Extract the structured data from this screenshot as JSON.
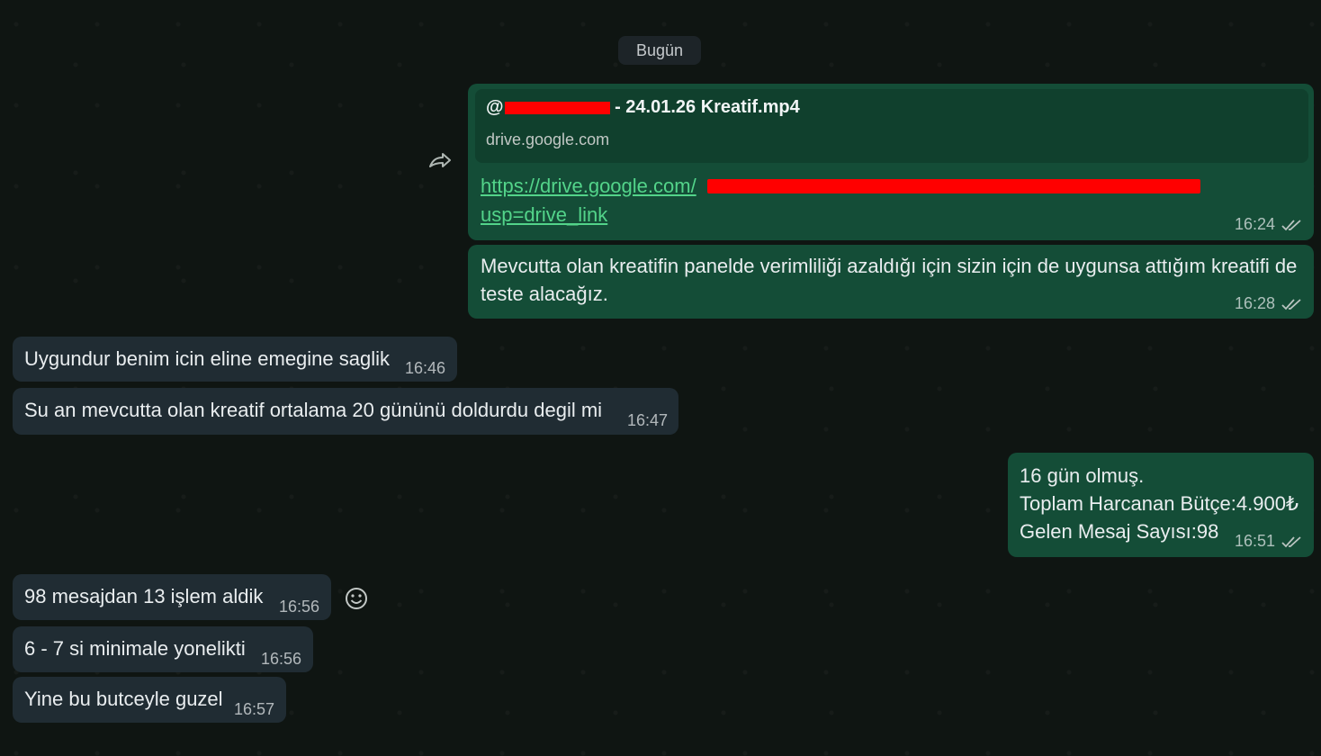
{
  "date_label": "Bugün",
  "outgoing": {
    "link_preview": {
      "title_prefix": "@",
      "title_suffix": " - 24.01.26 Kreatif.mp4",
      "domain": "drive.google.com",
      "link_line1": "https://drive.google.com/",
      "link_line2": "usp=drive_link",
      "time": "16:24"
    },
    "message_2": {
      "text": "Mevcutta olan kreatifin panelde verimliliği azaldığı için sizin için de uygunsa attığım kreatifi de teste alacağız.",
      "time": "16:28"
    },
    "message_3": {
      "line1": "16 gün olmuş.",
      "line2": "Toplam Harcanan Bütçe:4.900₺",
      "line3": "Gelen Mesaj Sayısı:98",
      "time": "16:51"
    }
  },
  "incoming": [
    {
      "text": "Uygundur benim icin eline emegine saglik",
      "time": "16:46"
    },
    {
      "text": "Su an mevcutta olan kreatif ortalama 20 gününü doldurdu degil mi",
      "time": "16:47"
    },
    {
      "text": "98 mesajdan 13 işlem aldik",
      "time": "16:56"
    },
    {
      "text": "6 - 7 si minimale yonelikti",
      "time": "16:56"
    },
    {
      "text": "Yine bu butceyle guzel",
      "time": "16:57"
    }
  ],
  "icons": {
    "forward": "forward-icon",
    "emoji": "emoji-icon",
    "read_receipt": "double-check-icon"
  },
  "colors": {
    "outgoing_bubble": "#144d37",
    "incoming_bubble": "#202c33",
    "link": "#53d48a",
    "redaction": "#ff0000"
  }
}
